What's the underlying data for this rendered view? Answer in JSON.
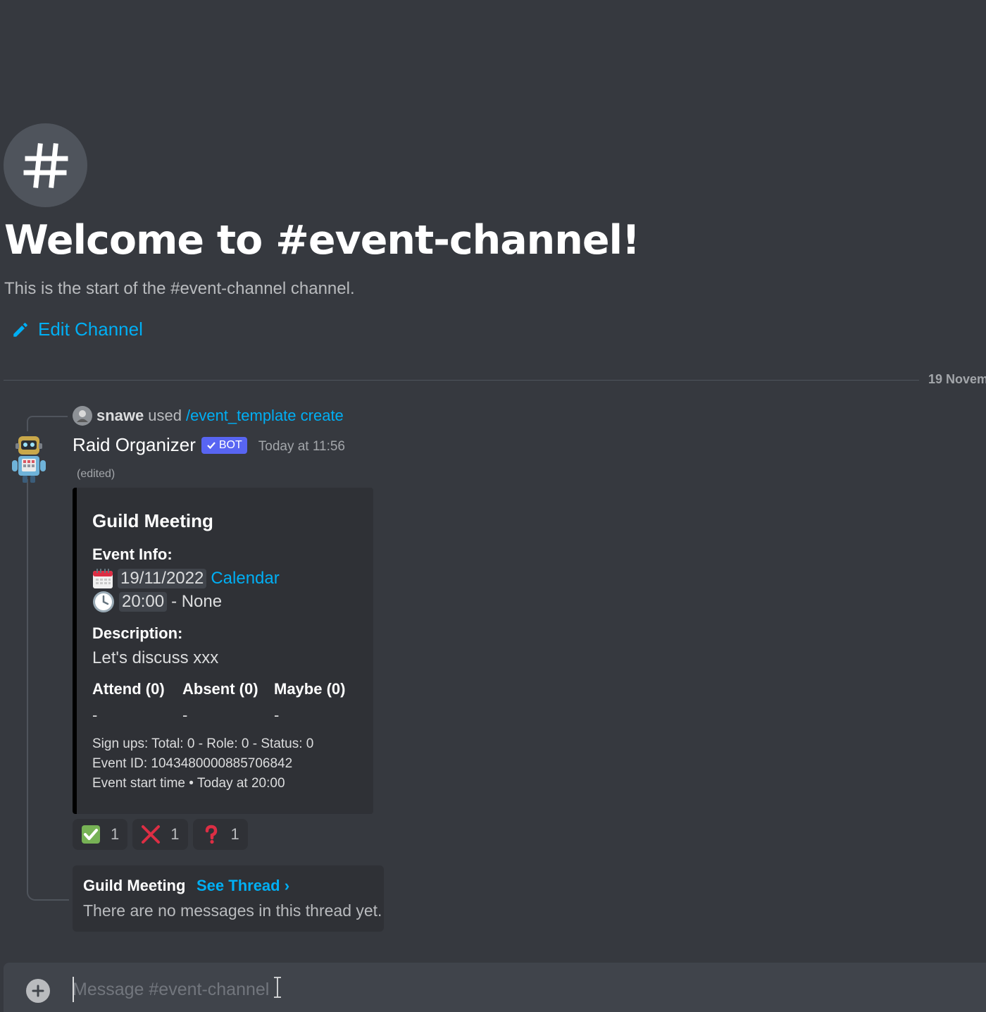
{
  "channel": {
    "icon": "hash-icon",
    "welcome_title": "Welcome to #event-channel!",
    "subtitle": "This is the start of the #event-channel channel.",
    "edit_label": "Edit Channel"
  },
  "divider": {
    "date_label": "19 Novem"
  },
  "message": {
    "reply": {
      "user": "snawe",
      "verb": "used",
      "command": "/event_template create"
    },
    "author": "Raid Organizer",
    "bot_tag": "BOT",
    "timestamp": "Today at 11:56",
    "edited": "(edited)",
    "embed": {
      "accent_color": "#000000",
      "title": "Guild Meeting",
      "event_info_label": "Event Info:",
      "date": "19/11/2022",
      "calendar_link": "Calendar",
      "time": "20:00",
      "time_suffix": "- None",
      "description_label": "Description:",
      "description": "Let's discuss xxx",
      "columns": [
        {
          "name": "Attend (0)",
          "value": "-"
        },
        {
          "name": "Absent (0)",
          "value": "-"
        },
        {
          "name": "Maybe (0)",
          "value": "-"
        }
      ],
      "footer": {
        "signups": "Sign ups: Total: 0 - Role: 0 - Status: 0",
        "event_id": "Event ID: 1043480000885706842",
        "start_label": "Event start time",
        "separator": "•",
        "start_value": "Today at 20:00"
      }
    },
    "reactions": [
      {
        "icon": "check-mark-icon",
        "count": "1"
      },
      {
        "icon": "cross-mark-icon",
        "count": "1"
      },
      {
        "icon": "question-mark-icon",
        "count": "1"
      }
    ],
    "thread": {
      "name": "Guild Meeting",
      "see_thread": "See Thread ›",
      "empty_text": "There are no messages in this thread yet."
    }
  },
  "composer": {
    "placeholder": "Message #event-channel"
  },
  "colors": {
    "background": "#36393f",
    "link": "#00aff4",
    "bot_tag": "#5865f2",
    "embed": "#2f3136"
  }
}
